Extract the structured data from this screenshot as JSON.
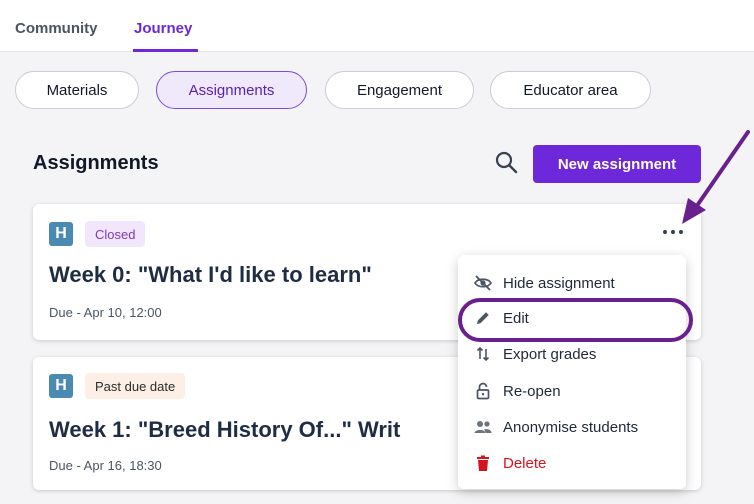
{
  "topnav": {
    "tabs": [
      {
        "label": "Community"
      },
      {
        "label": "Journey"
      }
    ]
  },
  "subnav": {
    "pills": [
      {
        "label": "Materials"
      },
      {
        "label": "Assignments"
      },
      {
        "label": "Engagement"
      },
      {
        "label": "Educator area"
      }
    ]
  },
  "page": {
    "title": "Assignments",
    "new_button": "New assignment"
  },
  "cards": [
    {
      "badge": "H",
      "status": "Closed",
      "title": "Week 0: \"What I'd like to learn\"",
      "due": "Due - Apr 10, 12:00"
    },
    {
      "badge": "H",
      "status": "Past due date",
      "title": "Week 1: \"Breed History Of...\" Writ",
      "due": "Due - Apr 16, 18:30"
    }
  ],
  "menu": {
    "items": [
      {
        "label": "Hide assignment",
        "icon": "eye-off-icon"
      },
      {
        "label": "Edit",
        "icon": "pencil-icon"
      },
      {
        "label": "Export grades",
        "icon": "sort-arrows-icon"
      },
      {
        "label": "Re-open",
        "icon": "unlock-icon"
      },
      {
        "label": "Anonymise students",
        "icon": "people-icon"
      },
      {
        "label": "Delete",
        "icon": "trash-icon"
      }
    ]
  },
  "colors": {
    "accent": "#6d28d9",
    "highlight": "#6a1f8e",
    "danger": "#d4141f",
    "badge": "#4a8ab0"
  }
}
